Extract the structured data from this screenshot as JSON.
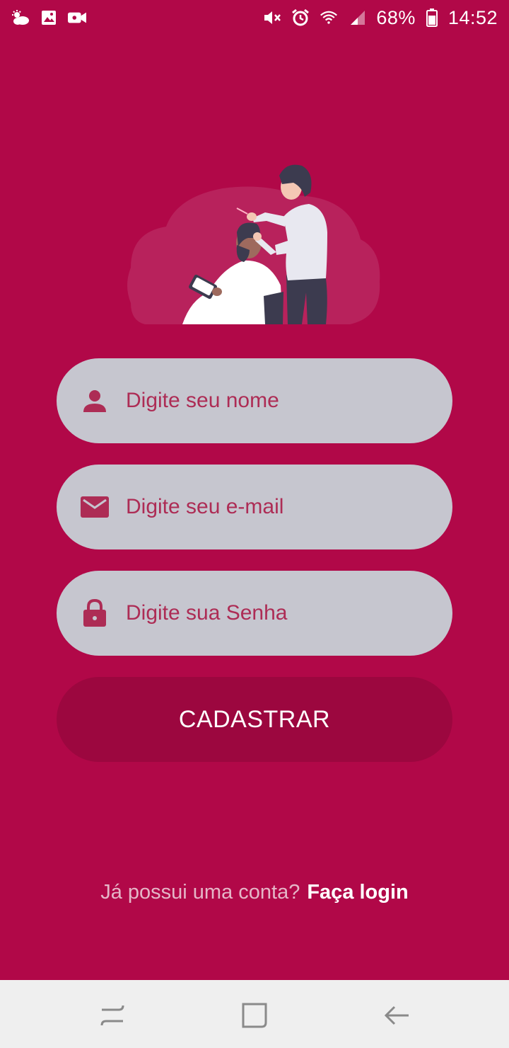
{
  "status_bar": {
    "left_icons": [
      "weather-icon",
      "gallery-icon",
      "video-camera-icon"
    ],
    "right_icons": [
      "mute-icon",
      "alarm-icon",
      "wifi-icon",
      "signal-icon",
      "battery-icon"
    ],
    "battery": "68%",
    "time": "14:52"
  },
  "illustration": {
    "name": "barber-cutting-hair-illustration"
  },
  "form": {
    "name_field": {
      "placeholder": "Digite seu nome",
      "icon": "person-icon"
    },
    "email_field": {
      "placeholder": "Digite seu e-mail",
      "icon": "envelope-icon"
    },
    "password_field": {
      "placeholder": "Digite sua Senha",
      "icon": "lock-icon"
    },
    "submit_label": "CADASTRAR"
  },
  "login_prompt": {
    "text": "Já possui uma conta?",
    "link": "Faça login"
  },
  "nav_bar": {
    "buttons": [
      "recent-apps-icon",
      "home-icon",
      "back-icon"
    ]
  },
  "colors": {
    "background": "#b10848",
    "field": "#c6c6cf",
    "button": "#9c073f",
    "accent_text": "#ad2c55"
  }
}
